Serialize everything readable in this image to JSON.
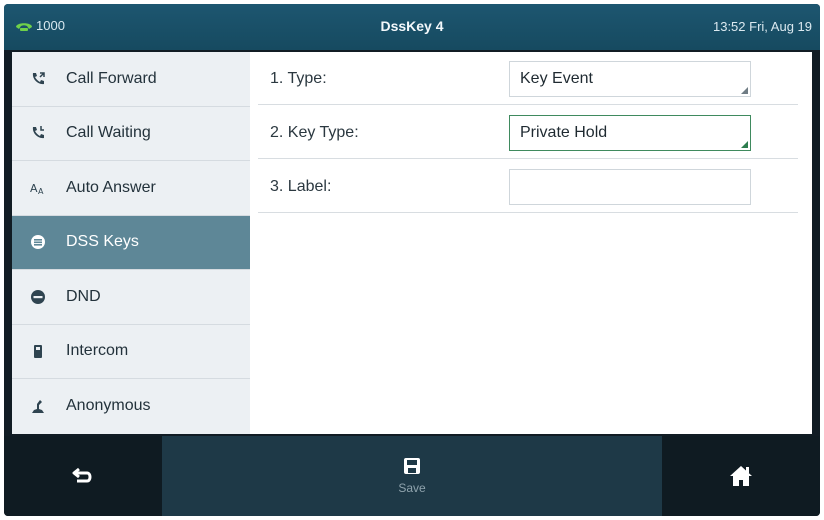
{
  "statusbar": {
    "line_number": "1000",
    "title": "DssKey 4",
    "datetime": "13:52 Fri, Aug 19"
  },
  "sidebar": {
    "items": [
      {
        "label": "Call Forward",
        "icon": "call-forward-icon"
      },
      {
        "label": "Call Waiting",
        "icon": "call-waiting-icon"
      },
      {
        "label": "Auto Answer",
        "icon": "auto-answer-icon"
      },
      {
        "label": "DSS Keys",
        "icon": "dss-keys-icon",
        "active": true
      },
      {
        "label": "DND",
        "icon": "dnd-icon"
      },
      {
        "label": "Intercom",
        "icon": "intercom-icon"
      },
      {
        "label": "Anonymous",
        "icon": "anonymous-icon"
      }
    ]
  },
  "form": {
    "rows": [
      {
        "label": "1. Type:",
        "value": "Key Event"
      },
      {
        "label": "2. Key Type:",
        "value": "Private Hold"
      },
      {
        "label": "3. Label:",
        "value": ""
      }
    ]
  },
  "softkeys": {
    "back_icon": "back-arrow-icon",
    "save_label": "Save",
    "save_icon": "save-icon",
    "home_icon": "home-icon"
  },
  "colors": {
    "accent": "#164a60",
    "active_item": "#5e8797",
    "focus_border": "#3f8a5e"
  }
}
